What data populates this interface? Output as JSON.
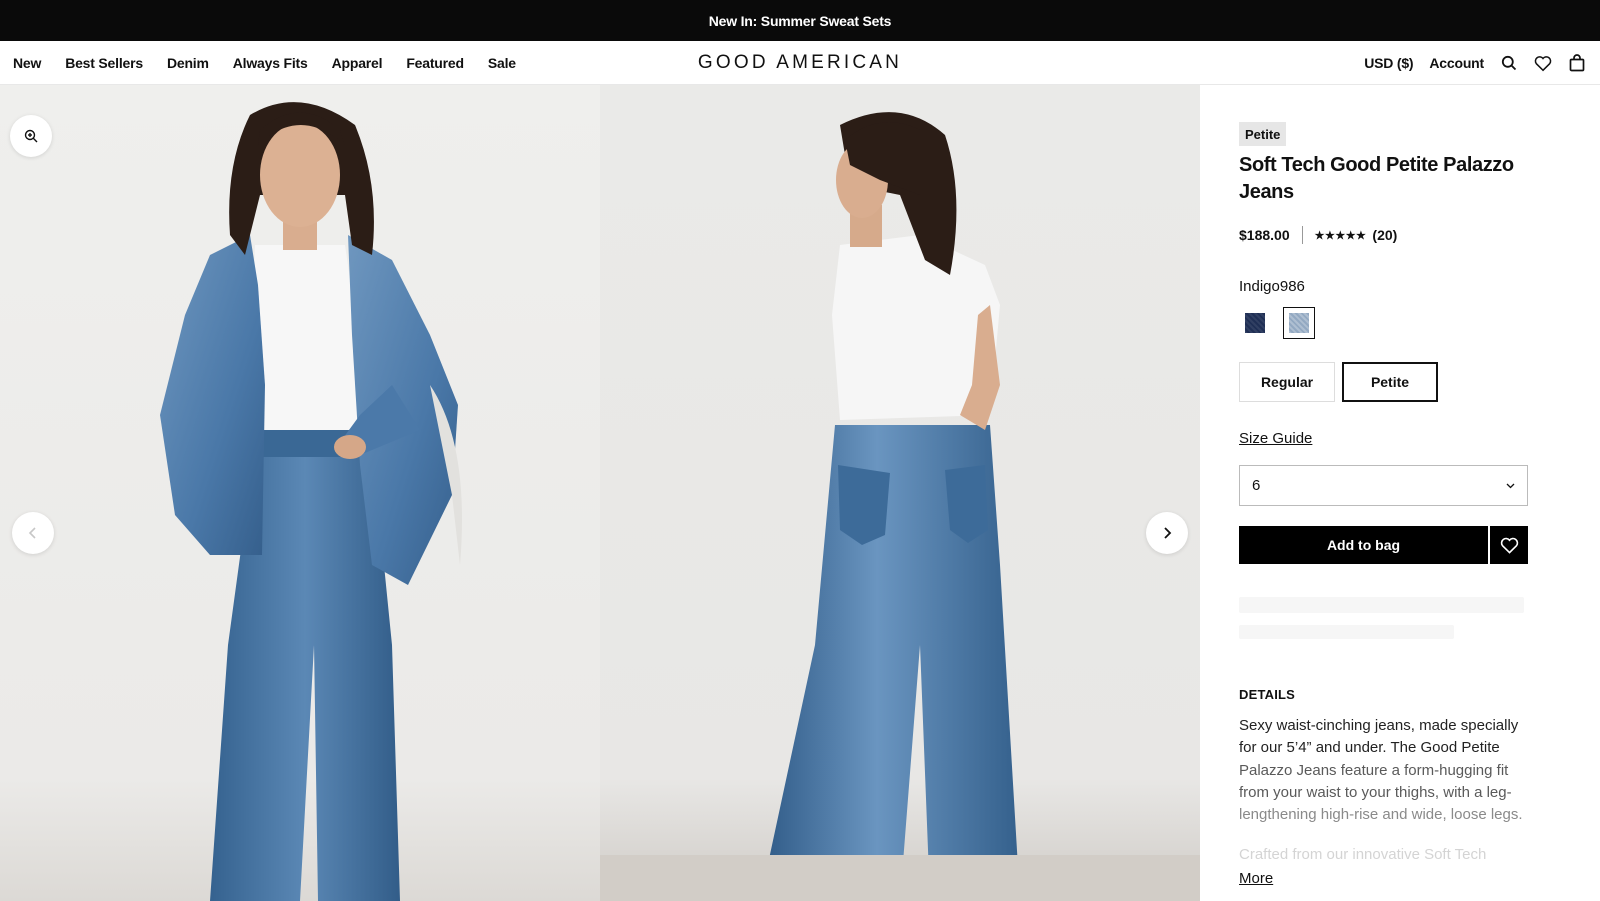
{
  "announcement": "New In: Summer Sweat Sets",
  "nav": {
    "items": [
      {
        "label": "New",
        "name": "nav-item-new"
      },
      {
        "label": "Best Sellers",
        "name": "nav-item-best-sellers"
      },
      {
        "label": "Denim",
        "name": "nav-item-denim"
      },
      {
        "label": "Always Fits",
        "name": "nav-item-always-fits"
      },
      {
        "label": "Apparel",
        "name": "nav-item-apparel"
      },
      {
        "label": "Featured",
        "name": "nav-item-featured"
      },
      {
        "label": "Sale",
        "name": "nav-item-sale"
      }
    ],
    "logo": "GOOD AMERICAN",
    "currency": "USD ($)",
    "account": "Account",
    "icons": [
      "search-icon",
      "heart-icon",
      "bag-icon"
    ]
  },
  "gallery": {
    "icons": [
      "zoom-icon",
      "chevron-left-icon",
      "chevron-right-icon"
    ]
  },
  "product": {
    "badge": "Petite",
    "title": "Soft Tech Good Petite Palazzo Jeans",
    "price": "$188.00",
    "stars": "★★★★★",
    "reviews": "(20)",
    "color_name": "Indigo986",
    "swatches": [
      {
        "name": "dark-indigo",
        "color": "#1f2f55",
        "selected": false
      },
      {
        "name": "light-indigo",
        "color": "#93a9c2",
        "selected": true
      }
    ],
    "fits": [
      {
        "label": "Regular",
        "selected": false
      },
      {
        "label": "Petite",
        "selected": true
      }
    ],
    "size_guide": "Size Guide",
    "size_selected": "6",
    "add_to_bag": "Add to bag",
    "details_heading": "DETAILS",
    "details_lines": [
      "Sexy waist-cinching jeans, made specially",
      "for our 5’4” and under. The Good Petite",
      "Palazzo Jeans feature a form-hugging fit",
      "from your waist to your thighs, with a leg-",
      "lengthening high-rise and wide, loose legs."
    ],
    "details_faded": "Crafted from our innovative Soft Tech",
    "more": "More"
  },
  "colors": {
    "topbar": "#0a0a0a",
    "denim": "#4a78a8",
    "denim_dark": "#2f5a86",
    "tee": "#f8f8f8",
    "hair": "#2b1d16",
    "skin": "#d9ad8f"
  }
}
